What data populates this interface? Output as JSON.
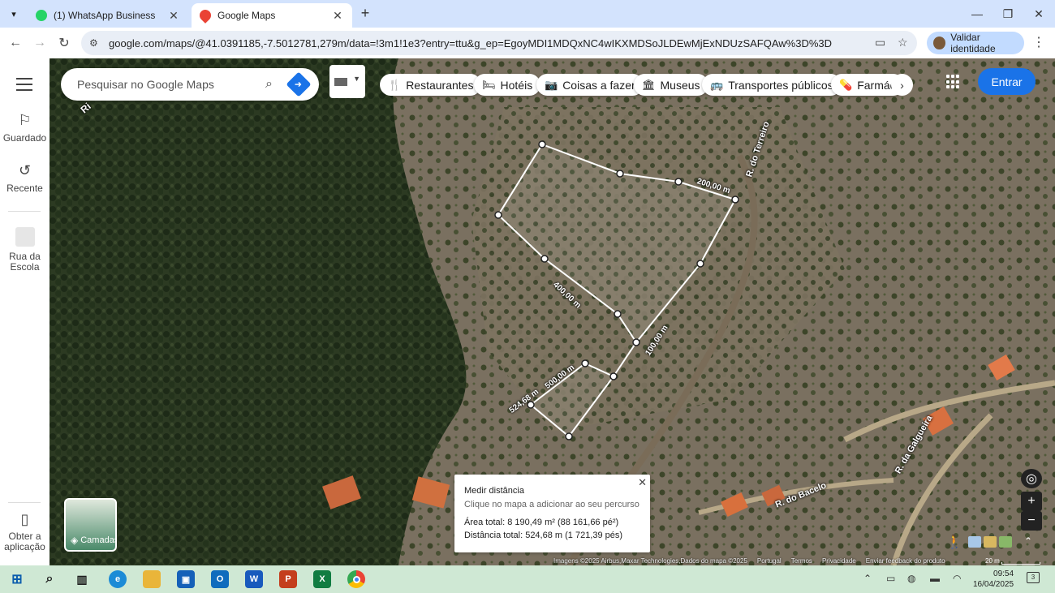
{
  "browser": {
    "tabs": [
      {
        "title": "(1) WhatsApp Business",
        "favicon_color": "#25d366",
        "active": false
      },
      {
        "title": "Google Maps",
        "favicon_color": "#ea4335",
        "active": true
      }
    ],
    "url": "google.com/maps/@41.0391185,-7.5012781,279m/data=!3m1!1e3?entry=ttu&g_ep=EgoyMDI1MDQxNC4wIKXMDSoJLDEwMjExNDUzSAFQAw%3D%3D",
    "identity_label": "Validar identidade"
  },
  "rail": {
    "saved": "Guardado",
    "recent": "Recente",
    "place": "Rua da Escola",
    "get_app": "Obter a aplicação"
  },
  "search": {
    "placeholder": "Pesquisar no Google Maps"
  },
  "chips": [
    {
      "icon": "restaurant-icon",
      "label": "Restaurantes"
    },
    {
      "icon": "hotel-icon",
      "label": "Hotéis"
    },
    {
      "icon": "camera-icon",
      "label": "Coisas a fazer"
    },
    {
      "icon": "museum-icon",
      "label": "Museus"
    },
    {
      "icon": "transit-icon",
      "label": "Transportes públicos"
    },
    {
      "icon": "pharmacy-icon",
      "label": "Farmácia"
    }
  ],
  "signin_label": "Entrar",
  "map_labels": {
    "road_terreiro": "R. do Terreiro",
    "road_galgueira": "R. da Galgueira",
    "road_bacelo": "R. do Bacelo",
    "road_top_left": "Ri"
  },
  "measure_labels": {
    "d200": "200,00 m",
    "d400": "400,00 m",
    "d100": "100,00 m",
    "d500": "500,00 m",
    "d524": "524,68 m"
  },
  "measure_panel": {
    "title": "Medir distância",
    "subtitle": "Clique no mapa a adicionar ao seu percurso",
    "area": "Área total: 8 190,49 m² (88 161,66 pé²)",
    "distance": "Distância total: 524,68 m (1 721,39 pés)"
  },
  "layers_label": "Camadas",
  "footer": {
    "imagery": "Imagens ©2025 Airbus,Maxar Technologies,Dados do mapa ©2025",
    "country": "Portugal",
    "terms": "Termos",
    "privacy": "Privacidade",
    "feedback": "Enviar feedback do produto",
    "scale": "20 m"
  },
  "taskbar": {
    "time": "09:54",
    "date": "16/04/2025",
    "notifications": "3"
  },
  "colors": {
    "accent": "#1a73e8",
    "tabstrip": "#d3e3fd",
    "taskbar": "#cfe8d4",
    "polygon": "#ffffff"
  }
}
